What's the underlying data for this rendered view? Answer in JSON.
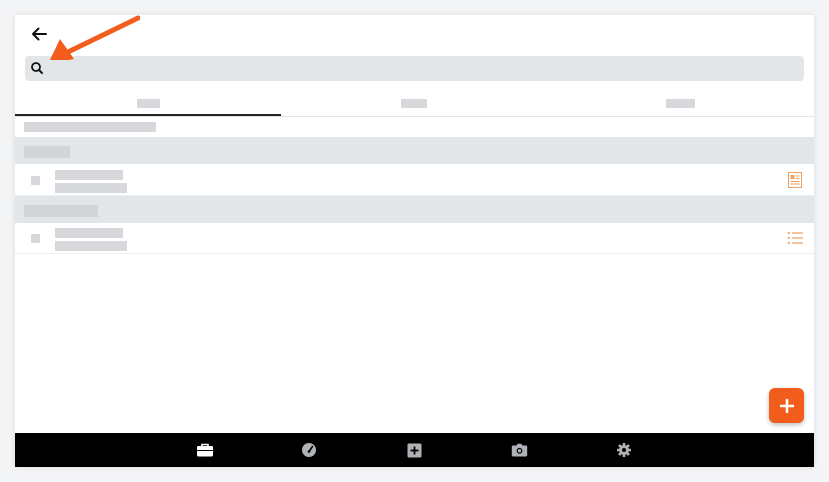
{
  "header": {
    "back_icon": "arrow-left-icon"
  },
  "search": {
    "placeholder": "",
    "value": "",
    "icon": "search-icon"
  },
  "tabs": [
    {
      "label": "",
      "selected": true
    },
    {
      "label": "",
      "selected": false
    },
    {
      "label": "",
      "selected": false
    }
  ],
  "results": {
    "summary": "",
    "sections": [
      {
        "title": "",
        "items": [
          {
            "title": "",
            "subtitle": "",
            "icon": "document-icon"
          }
        ]
      },
      {
        "title": "",
        "items": [
          {
            "title": "",
            "subtitle": "",
            "icon": "list-icon"
          }
        ]
      }
    ]
  },
  "fab": {
    "icon": "plus-icon"
  },
  "bottom_nav": [
    {
      "icon": "briefcase-icon",
      "active": true
    },
    {
      "icon": "gauge-icon",
      "active": false
    },
    {
      "icon": "plus-square-icon",
      "active": false
    },
    {
      "icon": "camera-icon",
      "active": false
    },
    {
      "icon": "gear-icon",
      "active": false
    }
  ],
  "annotation": {
    "type": "arrow",
    "points_to": "search-icon"
  },
  "colors": {
    "accent": "#f25c1c",
    "search_bg": "#e3e6e8",
    "section_bg": "#e3e6e8",
    "placeholder": "#d6d8db",
    "bottom_bar": "#000000",
    "nav_active": "#ffffff",
    "nav_inactive": "#aeb2b6",
    "tab_indicator": "#1f2326"
  }
}
